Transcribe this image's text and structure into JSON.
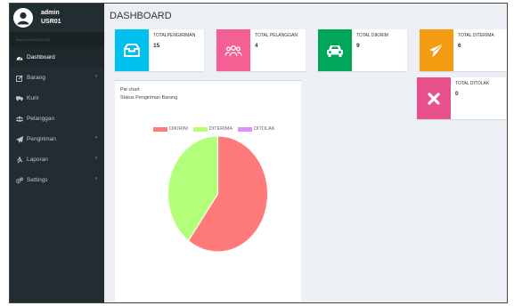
{
  "user": {
    "name": "admin",
    "id": "USR01"
  },
  "nav_header": "MAIN NAVIGATION",
  "menu": [
    {
      "label": "Dashboard",
      "icon": "dashboard-icon",
      "chevron": false
    },
    {
      "label": "Barang",
      "icon": "edit-icon",
      "chevron": true
    },
    {
      "label": "Kurir",
      "icon": "truck-icon",
      "chevron": false
    },
    {
      "label": "Pelanggan",
      "icon": "users-icon",
      "chevron": false
    },
    {
      "label": "Pengiriman",
      "icon": "send-icon",
      "chevron": true
    },
    {
      "label": "Laporan",
      "icon": "report-icon",
      "chevron": true
    },
    {
      "label": "Settings",
      "icon": "gears-icon",
      "chevron": true
    }
  ],
  "page_title": "DASHBOARD",
  "stats": [
    {
      "label": "TOTALPENGIRIMAN",
      "value": "15",
      "color": "#00c0ef",
      "icon": "inbox-icon"
    },
    {
      "label": "TOTAL PELANGGAN",
      "value": "4",
      "color": "#f56094",
      "icon": "customers-icon"
    },
    {
      "label": "TOTAL DIKIRIM",
      "value": "9",
      "color": "#00a65a",
      "icon": "car-icon"
    },
    {
      "label": "TOTAL DITERIMA",
      "value": "6",
      "color": "#f39c12",
      "icon": "paper-plane-icon"
    },
    {
      "label": "TOTAL DITOLAK",
      "value": "0",
      "color": "#e8508c",
      "icon": "x-icon"
    }
  ],
  "chart_box": {
    "heading": "Pie chart",
    "subheading": "Status Pengiriman Barang"
  },
  "chart_data": {
    "type": "pie",
    "title": "Status Pengiriman Barang",
    "labels": [
      "DIKIRIM",
      "DITERIMA",
      "DITOLAK"
    ],
    "values": [
      9,
      6,
      0
    ],
    "colors": [
      "#ff7b7b",
      "#b4ff7a",
      "#e08ff7"
    ],
    "legend": "top"
  }
}
